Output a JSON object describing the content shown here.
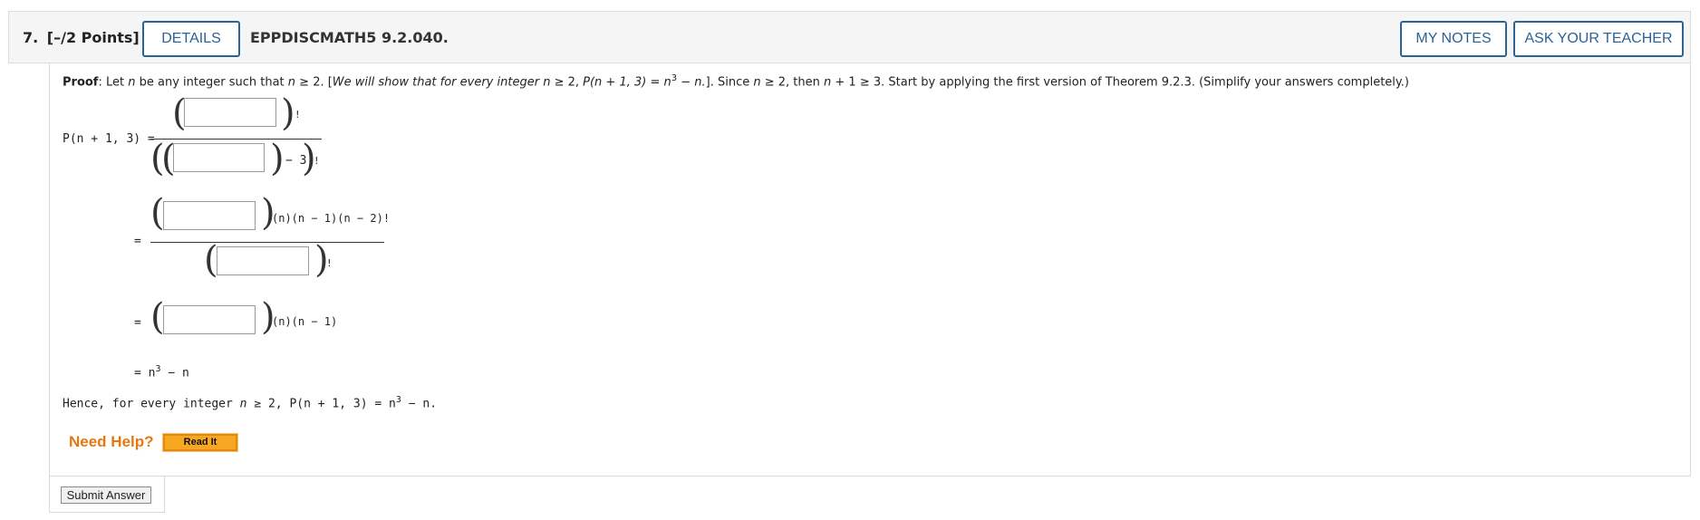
{
  "header": {
    "question_number": "7.",
    "points": "[–/2 Points]",
    "details_label": "DETAILS",
    "code": "EPPDISCMATH5 9.2.040.",
    "my_notes_label": "MY NOTES",
    "ask_teacher_label": "ASK YOUR TEACHER"
  },
  "proof": {
    "label": "Proof",
    "let": ": Let ",
    "n": "n",
    "be_any": " be any integer such that ",
    "geq2": " ≥ 2. [",
    "show": "We will show that for every integer ",
    "geq2b": " ≥ 2, ",
    "p_expr": "P(n + 1, 3) = n",
    "exp3": "3",
    "minus_n": " − n.",
    "since": "]. Since ",
    "since2": " ≥ 2, then ",
    "plus1": " + 1 ≥ 3. Start by applying the first version of Theorem 9.2.3. (Simplify your answers completely.)"
  },
  "math": {
    "lhs": "P(n + 1, 3) =",
    "minus3": "− 3",
    "fact": "!",
    "eq": "=",
    "row2_tail": "(n)(n − 1)(n − 2)!",
    "row3_tail": "(n)(n − 1)",
    "row4": "= n",
    "row4_exp": "3",
    "row4_tail": " − n"
  },
  "conclusion": {
    "text": "Hence, for every integer ",
    "n": "n",
    "tail": " ≥ 2, P(n + 1, 3) = n",
    "exp": "3",
    "end": " − n."
  },
  "help": {
    "need_help": "Need Help?",
    "read_it": "Read It"
  },
  "submit_label": "Submit Answer"
}
